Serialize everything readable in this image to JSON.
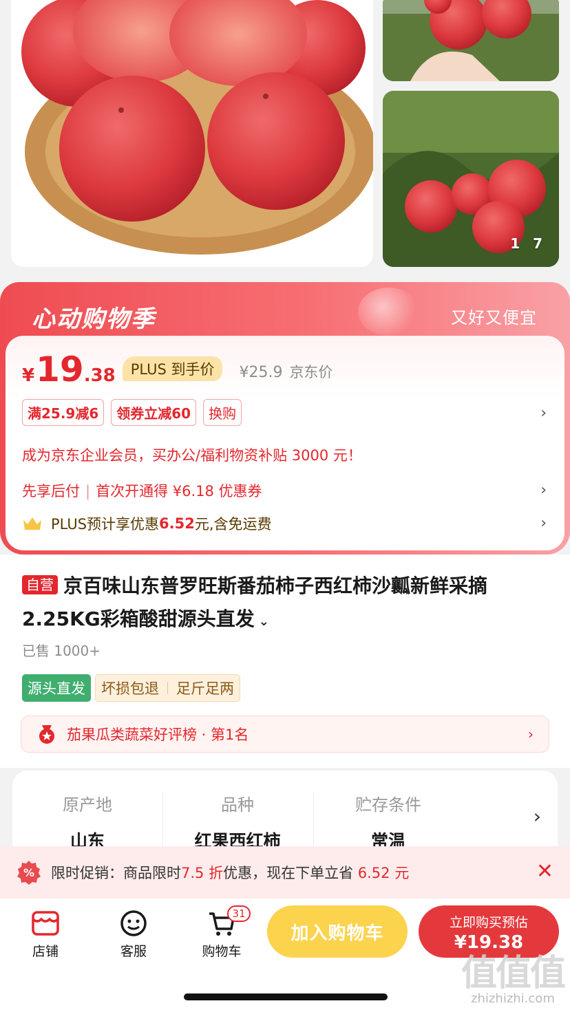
{
  "gallery": {
    "counter": "1 7"
  },
  "promo": {
    "title": "心动购物季",
    "slogan": "又好又便宜",
    "price": {
      "currency": "¥",
      "integer": "19",
      "decimal": ".38",
      "plus_tag": "PLUS 到手价",
      "original": "¥25.9",
      "original_label": "京东价"
    },
    "coupons": [
      "满25.9减6",
      "领券立减60",
      "换购"
    ],
    "enterprise_line": "成为京东企业会员，买办公/福利物资补贴 3000 元！",
    "bnpl": {
      "left": "先享后付",
      "sep": "|",
      "right": "首次开通得 ¥6.18 优惠券"
    },
    "plus_line": {
      "prefix": "PLUS预计享优惠",
      "amount": "6.52",
      "suffix": "元,含免运费"
    }
  },
  "product": {
    "self_tag": "自营",
    "title": "京百味山东普罗旺斯番茄柿子西红柿沙瓤新鲜采摘2.25KG彩箱酸甜源头直发",
    "sold": "已售 1000+",
    "service_tags": {
      "green": "源头直发",
      "group": [
        "坏损包退",
        "足斤足两"
      ]
    },
    "rank": "茄果瓜类蔬菜好评榜 · 第1名"
  },
  "specs": [
    {
      "label": "原产地",
      "value": "山东"
    },
    {
      "label": "品种",
      "value": "红果西红柿"
    },
    {
      "label": "贮存条件",
      "value": "常温"
    }
  ],
  "limit_promo": {
    "prefix": "限时促销：商品限时",
    "discount": "7.5 折",
    "middle": "优惠，现在下单立省",
    "saving": "6.52 元"
  },
  "bottom_bar": {
    "store": "店铺",
    "service": "客服",
    "cart": "购物车",
    "cart_count": "31",
    "add_to_cart": "加入购物车",
    "buy_line1": "立即购买预估",
    "buy_line2": "¥19.38"
  },
  "watermark": {
    "big": "值值值",
    "small": "zhizhizhi.com"
  },
  "colors": {
    "accent_red": "#e4272d",
    "cart_yellow": "#fcd34d",
    "service_green": "#3fae6e"
  },
  "icons": [
    "store-icon",
    "service-icon",
    "cart-icon",
    "crown-icon",
    "medal-icon",
    "discount-icon",
    "close-icon",
    "chevron-right-icon",
    "chevron-down-icon"
  ]
}
